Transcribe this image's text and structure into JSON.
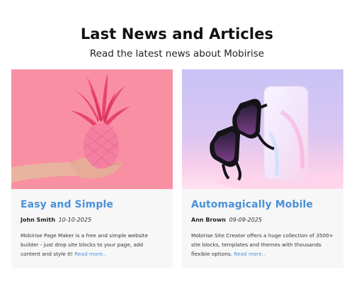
{
  "header": {
    "title": "Last News and Articles",
    "subtitle": "Read the latest news about Mobirise"
  },
  "articles": [
    {
      "title": "Easy and Simple",
      "author": "John Smith",
      "date": "10-10-2025",
      "text": "Mobirise Page Maker is a free and simple website builder - just drop site blocks to your page, add content and style it!",
      "link_label": "Read more..",
      "image_icon": "pink-pineapple-in-hand"
    },
    {
      "title": "Automagically Mobile",
      "author": "Ann Brown",
      "date": "09-09-2025",
      "text": "Mobirise Site Creator offers a huge collection of 3500+ site blocks, templates and themes with thousands flexible options.",
      "link_label": "Read more..",
      "image_icon": "sunglasses-on-block"
    }
  ],
  "colors": {
    "accent": "#4a90d9",
    "card_bg": "#f7f7f7",
    "pink_bg": "#f98fa2",
    "lavender_bg": "#c9c4f6"
  }
}
